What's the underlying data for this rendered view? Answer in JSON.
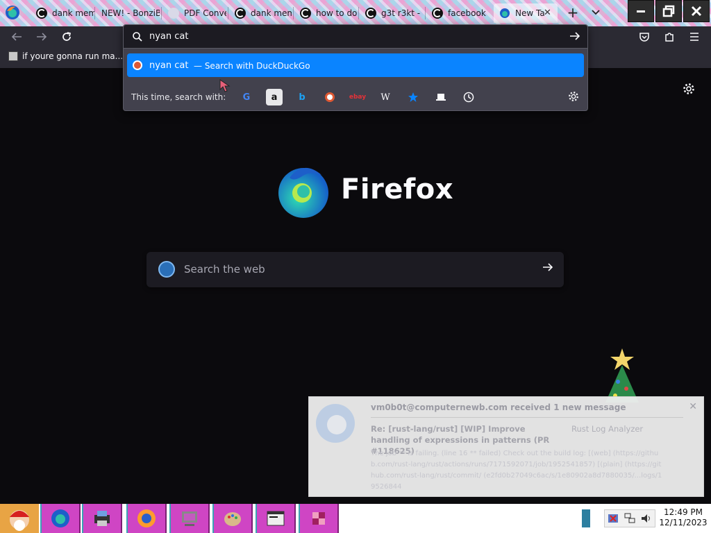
{
  "tabs": [
    {
      "title": "dank mem",
      "icon": "google-icon"
    },
    {
      "title": "NEW! - BonziB",
      "icon": "none"
    },
    {
      "title": "PDF Conve",
      "icon": "discord-icon"
    },
    {
      "title": "dank mem",
      "icon": "google-icon"
    },
    {
      "title": "how to do",
      "icon": "google-icon"
    },
    {
      "title": "g3t r3kt -",
      "icon": "google-icon"
    },
    {
      "title": "facebook",
      "icon": "google-icon"
    },
    {
      "title": "New Ta",
      "icon": "firefox-icon",
      "active": true
    }
  ],
  "bookmarks": [
    {
      "label": "if youre gonna run ma..."
    }
  ],
  "urlbar": {
    "value": "nyan cat",
    "suggestion": {
      "term": "nyan cat",
      "action": "— Search with DuckDuckGo"
    },
    "oneoff_label": "This time, search with:",
    "engines": [
      "google-icon",
      "amazon-icon",
      "bing-icon",
      "duckduckgo-icon",
      "ebay-icon",
      "wikipedia-icon",
      "bookmarks-icon",
      "tabs-icon",
      "history-icon"
    ]
  },
  "newtab": {
    "wordmark": "Firefox",
    "search_placeholder": "Search the web"
  },
  "notification": {
    "header": "vm0b0t@computernewb.com received 1 new message",
    "subject": "Re: [rust-lang/rust] [WIP] Improve handling of expressions in patterns (PR #118625)",
    "from": "Rust Log Analyzer",
    "body": "The job ** is failing. (line 16 ** failed) Check out the build log: [(web] (https://github.com/rust-lang/rust/actions/runs/7171592071/job/1952541857) [(plain] (https://github.com/rust-lang/rust/commit/ (e2fd0b27049c6ac/s/1e80902a8d7880035/...logs/19526844"
  },
  "taskbar": {
    "time": "12:49 PM",
    "date": "12/11/2023"
  },
  "colors": {
    "accent": "#0a84ff",
    "page_bg": "#0b0a0d",
    "taskbar_btn": "#cf45c4"
  }
}
